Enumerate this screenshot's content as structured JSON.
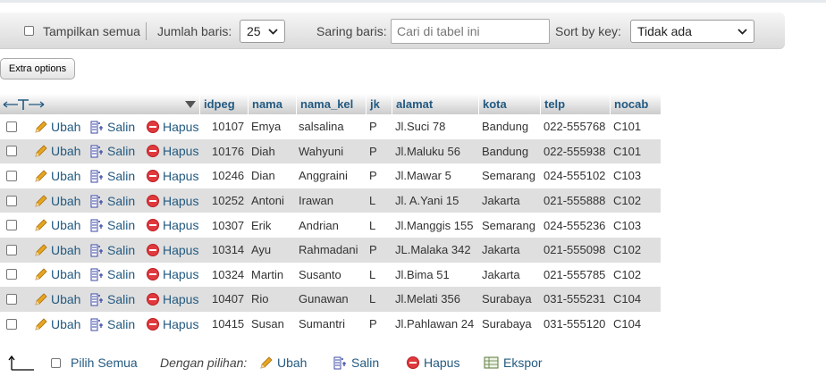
{
  "toolbar": {
    "show_all_label": "Tampilkan semua",
    "rows_label": "Jumlah baris:",
    "rows_value": "25",
    "filter_label": "Saring baris:",
    "filter_placeholder": "Cari di tabel ini",
    "sort_label": "Sort by key:",
    "sort_value": "Tidak ada"
  },
  "extra_options_label": "Extra options",
  "table": {
    "columns": [
      "idpeg",
      "nama",
      "nama_kel",
      "jk",
      "alamat",
      "kota",
      "telp",
      "nocab"
    ],
    "actions": {
      "edit": "Ubah",
      "copy": "Salin",
      "delete": "Hapus"
    },
    "rows": [
      [
        "10107",
        "Emya",
        "salsalina",
        "P",
        "Jl.Suci 78",
        "Bandung",
        "022-555768",
        "C101"
      ],
      [
        "10176",
        "Diah",
        "Wahyuni",
        "P",
        "Jl.Maluku 56",
        "Bandung",
        "022-555938",
        "C101"
      ],
      [
        "10246",
        "Dian",
        "Anggraini",
        "P",
        "Jl.Mawar 5",
        "Semarang",
        "024-555102",
        "C103"
      ],
      [
        "10252",
        "Antoni",
        "Irawan",
        "L",
        "Jl. A.Yani 15",
        "Jakarta",
        "021-555888",
        "C102"
      ],
      [
        "10307",
        "Erik",
        "Andrian",
        "L",
        "Jl.Manggis 155",
        "Semarang",
        "024-555236",
        "C103"
      ],
      [
        "10314",
        "Ayu",
        "Rahmadani",
        "P",
        "JL.Malaka 342",
        "Jakarta",
        "021-555098",
        "C102"
      ],
      [
        "10324",
        "Martin",
        "Susanto",
        "L",
        "Jl.Bima 51",
        "Jakarta",
        "021-555785",
        "C102"
      ],
      [
        "10407",
        "Rio",
        "Gunawan",
        "L",
        "Jl.Melati 356",
        "Surabaya",
        "031-555231",
        "C104"
      ],
      [
        "10415",
        "Susan",
        "Sumantri",
        "P",
        "Jl.Pahlawan 24",
        "Surabaya",
        "031-555120",
        "C104"
      ]
    ]
  },
  "footer": {
    "select_all_label": "Pilih Semua",
    "with_selected_label": "Dengan pilihan:",
    "edit_label": "Ubah",
    "copy_label": "Salin",
    "delete_label": "Hapus",
    "export_label": "Ekspor"
  },
  "colors": {
    "link": "#235a81",
    "row_alt": "#dfdfdf",
    "delete_icon": "#e0393e",
    "edit_icon": "#e6a521"
  }
}
